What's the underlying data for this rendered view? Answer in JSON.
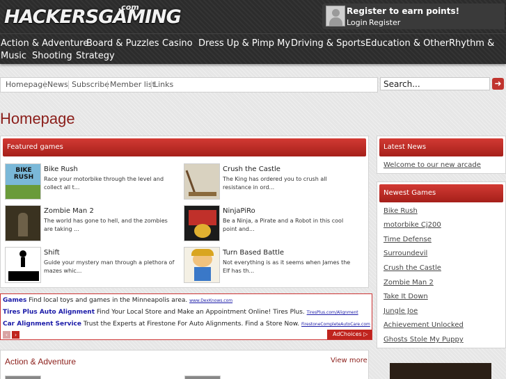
{
  "header": {
    "logo": "HACKERSGAMING",
    "logo_suffix": ".com",
    "user_box": {
      "title": "Register to earn points!",
      "login": "Login",
      "register": "Register"
    }
  },
  "categories": [
    "Action & Adventure",
    "Board & Puzzles",
    "Casino",
    "Dress Up & Pimp My",
    "Driving & Sports",
    "Education & Other",
    "Rhythm &",
    "Music",
    "Shooting",
    "Strategy"
  ],
  "subnav": [
    "Homepage",
    "News",
    "Subscribe",
    "Member list",
    "Links"
  ],
  "search": {
    "value": "Search..."
  },
  "page_title": "Homepage",
  "featured": {
    "title": "Featured games",
    "games": [
      {
        "name": "Bike Rush",
        "desc": "Race your motorbike through the level and collect all t...",
        "thumb_text": "BIKE RUSH"
      },
      {
        "name": "Crush the Castle",
        "desc": "The King has ordered you to crush all resistance in ord..."
      },
      {
        "name": "Zombie Man 2",
        "desc": "The world has gone to hell, and the zombies are taking ..."
      },
      {
        "name": "NinjaPiRo",
        "desc": "Be a Ninja, a Pirate and a Robot in this cool point and..."
      },
      {
        "name": "Shift",
        "desc": "Guide your mystery man through a plethora of mazes whic..."
      },
      {
        "name": "Turn Based Battle",
        "desc": "Not everything is as it seems when James the Elf has th..."
      }
    ]
  },
  "ads": {
    "rows": [
      {
        "title": "Games",
        "text": "Find local toys and games in the Minneapolis area.",
        "url": "www.DexKnows.com"
      },
      {
        "title": "Tires Plus Auto Alignment",
        "text": "Find Your Local Store and Make an Appointment Online! Tires Plus.",
        "url": "TiresPlus.com/Alignment"
      },
      {
        "title": "Car Alignment Service",
        "text": "Trust the Experts at Firestone For Auto Alignments. Find a Store Now.",
        "url": "FirestoneCompleteAutoCare.com"
      }
    ],
    "prev": "‹",
    "next": "›",
    "adchoices": "AdChoices ▷"
  },
  "action_section": {
    "title": "Action & Adventure",
    "view_more": "View more"
  },
  "latest_news": {
    "title": "Latest News",
    "items": [
      "Welcome to our new arcade"
    ]
  },
  "newest_games": {
    "title": "Newest Games",
    "items": [
      "Bike Rush",
      "motorbike Cj200",
      "Time Defense",
      "Surroundevil",
      "Crush the Castle",
      "Zombie Man 2",
      "Take It Down",
      "Jungle Joe",
      "Achievement Unlocked",
      "Ghosts Stole My Puppy"
    ]
  },
  "icons": {
    "search_button": "arrow-right-icon",
    "avatar": "user-silhouette-icon"
  },
  "colors": {
    "accent": "#a51f1a",
    "header_bg": "#2c2c2c",
    "link_blue": "#1a1aa8"
  }
}
